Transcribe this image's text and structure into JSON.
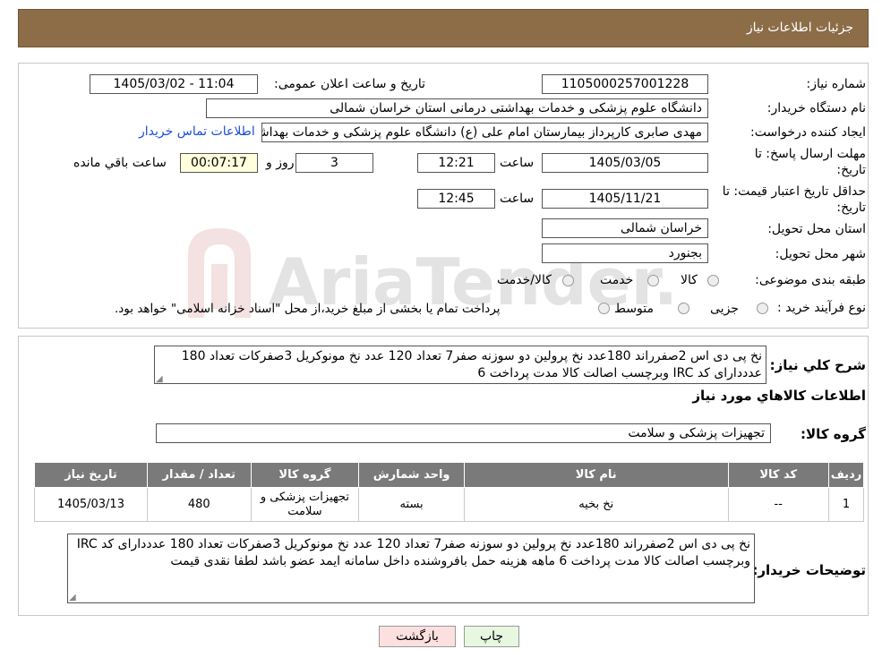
{
  "header": {
    "title": "جزئیات اطلاعات نیاز"
  },
  "form": {
    "need_number_label": "شماره نیاز:",
    "need_number": "1105000257001228",
    "announce_label": "تاریخ و ساعت اعلان عمومی:",
    "announce_value": "1405/03/02 - 11:04",
    "buyer_org_label": "نام دستگاه خریدار:",
    "buyer_org": "دانشگاه علوم پزشکی و خدمات بهداشتی درمانی استان خراسان شمالی",
    "creator_label": "ایجاد کننده درخواست:",
    "creator": "مهدی صابری کارپرداز بیمارستان امام علی (ع) دانشگاه علوم پزشکی و خدمات بهداشتی",
    "contact_link": "اطلاعات تماس خریدار",
    "deadline_label_1": "مهلت ارسال پاسخ: تا",
    "deadline_label_2": "تاریخ:",
    "deadline_date": "1405/03/05",
    "time_label": "ساعت",
    "deadline_time": "12:21",
    "days_value": "3",
    "days_label": "روز و",
    "remaining_value": "00:07:17",
    "remaining_label": "ساعت باقي مانده",
    "validity_label_1": "حداقل تاریخ اعتبار قیمت: تا",
    "validity_label_2": "تاریخ:",
    "validity_date": "1405/11/21",
    "validity_time_label": "ساعت",
    "validity_time": "12:45",
    "province_label": "استان محل تحویل:",
    "province": "خراسان شمالی",
    "city_label": "شهر محل تحویل:",
    "city": "بجنورد",
    "category_label": "طبقه بندی موضوعی:",
    "category_options": [
      "کالا",
      "خدمت",
      "کالا/خدمت"
    ],
    "process_label": "نوع فرآیند خرید :",
    "process_options": [
      "جزیی",
      "متوسط"
    ],
    "process_note": "پرداخت تمام یا بخشی از مبلغ خرید،از محل \"اسناد خزانه اسلامی\" خواهد بود."
  },
  "summary": {
    "label": "شرح کلي نياز:",
    "text": "نخ پی دی اس 2صفرراند 180عدد نخ پرولین دو سوزنه صفر7 تعداد 120 عدد نخ مونوکریل 3صفرکات تعداد 180 عدددارای کد IRC وبرچسب اصالت  کالا مدت پرداخت 6"
  },
  "items_section": {
    "title": "اطلاعات کالاهاي مورد نياز",
    "group_label": "گروه کالا:",
    "group_value": "تجهیزات پزشکی و سلامت",
    "columns": [
      "ردیف",
      "کد کالا",
      "نام کالا",
      "واحد شمارش",
      "گروه کالا",
      "تعداد / مقدار",
      "تاریخ نیاز"
    ],
    "rows": [
      [
        "1",
        "--",
        "نخ بخیه",
        "بسته",
        "تجهیزات پزشکی و سلامت",
        "480",
        "1405/03/13"
      ]
    ]
  },
  "buyer_notes": {
    "label": "توضیحات خریدار:",
    "text": "نخ پی دی اس 2صفرراند 180عدد نخ پرولین دو سوزنه صفر7 تعداد 120 عدد نخ مونوکریل 3صفرکات تعداد 180 عدددارای کد IRC وبرچسب اصالت  کالا مدت پرداخت 6 ماهه هزینه حمل بافروشنده داخل سامانه ایمد عضو باشد لطفا نقدی قیمت"
  },
  "buttons": {
    "print": "چاپ",
    "back": "بازگشت"
  },
  "watermark": {
    "text": "AriaTender.neT"
  },
  "colors": {
    "header_bg": "#8c6d47",
    "table_header": "#7a7a7a",
    "link": "#1a4fd6",
    "back_btn": "#fce0e0",
    "print_btn": "#e6f8e0"
  }
}
